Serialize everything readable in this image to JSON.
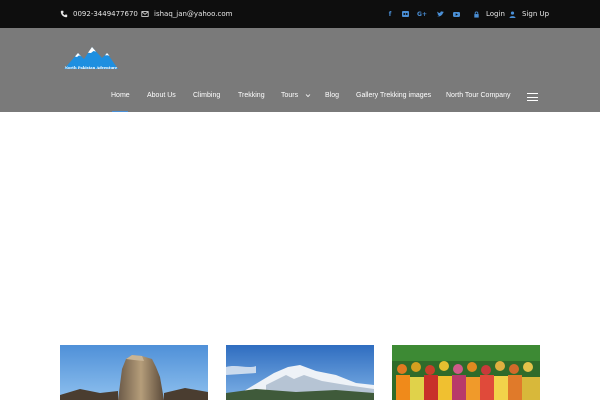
{
  "topbar": {
    "phone": "0092-3449477670",
    "email": "ishaq_jan@yahoo.com",
    "social_icons": [
      "facebook-icon",
      "flickr-icon",
      "google-plus-icon",
      "twitter-icon",
      "youtube-icon"
    ],
    "login_label": "Login",
    "signup_label": "Sign Up",
    "icon_color": "#4a8fd6"
  },
  "header": {
    "logo_text": "North Pakistan Adventure",
    "nav": [
      {
        "label": "Home"
      },
      {
        "label": "About Us"
      },
      {
        "label": "Climbing"
      },
      {
        "label": "Trekking"
      },
      {
        "label": "Tours"
      },
      {
        "label": "Blog"
      },
      {
        "label": "Gallery Trekking images"
      },
      {
        "label": "North Tour Company"
      }
    ],
    "active_nav": "Home",
    "background": "#7a7a7a",
    "accent": "#4a8fd6"
  },
  "gallery": {
    "cards": [
      {
        "image": "rocky-mountain-peak-photo"
      },
      {
        "image": "snow-capped-mountain-photo"
      },
      {
        "image": "festival-crowd-photo"
      }
    ]
  }
}
